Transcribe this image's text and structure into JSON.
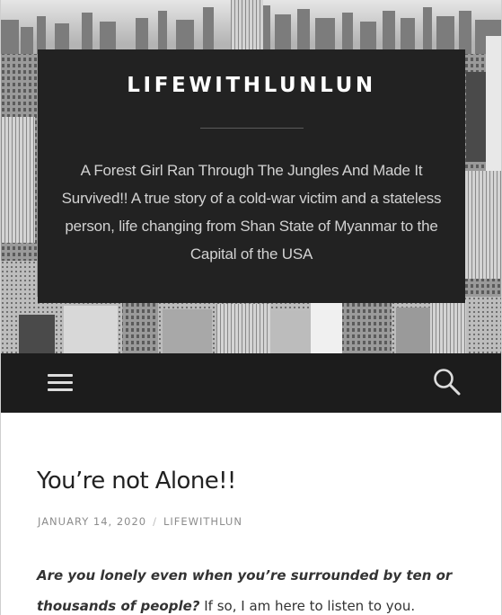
{
  "header": {
    "site_title": "LIFEWITHLUNLUN",
    "tagline": "A Forest Girl Ran Through The Jungles And Made It Survived!! A true story of a cold-war victim and a stateless person, life changing from Shan State of Myanmar to the Capital of the USA"
  },
  "nav": {
    "menu_icon": "hamburger-menu-icon",
    "search_icon": "search-icon"
  },
  "post": {
    "title": "You’re not Alone!!",
    "date": "JANUARY 14, 2020",
    "separator": "/",
    "author": "LIFEWITHLUN",
    "body_emphasis_line1": "Are you lonely even when you’re surrounded by ten or",
    "body_emphasis_line2": "thousands of people?",
    "body_rest": " If so, I am here to listen to you."
  },
  "colors": {
    "header_box": "#222222",
    "nav_bar": "#1c1c1c",
    "title_text": "#ffffff",
    "tagline_text": "#d2d2d2",
    "post_title": "#222222",
    "meta_text": "#8c8c8c"
  }
}
